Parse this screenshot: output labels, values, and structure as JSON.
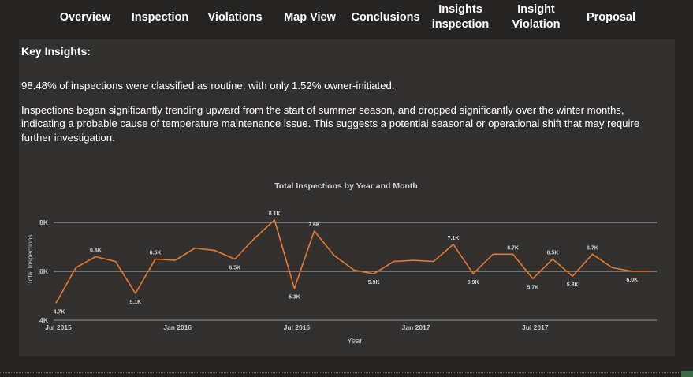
{
  "nav": {
    "tabs": [
      {
        "label": "Overview"
      },
      {
        "label": "Inspection"
      },
      {
        "label": "Violations"
      },
      {
        "label": "Map View"
      },
      {
        "label": "Conclusions"
      },
      {
        "label": "Insights\ninspection"
      },
      {
        "label": "Insight\nViolation"
      },
      {
        "label": "Proposal"
      }
    ]
  },
  "panel": {
    "title": "Key Insights:",
    "insight_1": "98.48% of inspections were classified as routine, with only 1.52% owner-initiated.",
    "insight_2": "Inspections began significantly trending upward from the start of summer season, and dropped significantly over the winter months, indicating a probable cause of temperature maintenance issue. This suggests a potential seasonal or operational shift that may require further investigation."
  },
  "colors": {
    "background": "#252423",
    "panel": "#323130",
    "line": "#e8792b",
    "text": "#ffffff"
  },
  "chart_data": {
    "type": "line",
    "title": "Total Inspections by Year and Month",
    "xlabel": "Year",
    "ylabel": "Total Inspections",
    "x_ticks": [
      "Jul 2015",
      "Jan 2016",
      "Jul 2016",
      "Jan 2017",
      "Jul 2017"
    ],
    "y_ticks": [
      "4K",
      "6K",
      "8K"
    ],
    "ylim": [
      4000,
      8000
    ],
    "x": [
      "2015-07",
      "2015-08",
      "2015-09",
      "2015-10",
      "2015-11",
      "2015-12",
      "2016-01",
      "2016-02",
      "2016-03",
      "2016-04",
      "2016-05",
      "2016-06",
      "2016-07",
      "2016-08",
      "2016-09",
      "2016-10",
      "2016-11",
      "2016-12",
      "2017-01",
      "2017-02",
      "2017-03",
      "2017-04",
      "2017-05",
      "2017-06",
      "2017-07",
      "2017-08",
      "2017-09",
      "2017-10",
      "2017-11",
      "2017-12",
      "2018-01"
    ],
    "values": [
      4700,
      6150,
      6600,
      6400,
      5100,
      6500,
      6450,
      6950,
      6850,
      6500,
      7350,
      8100,
      5300,
      7650,
      6650,
      6050,
      5900,
      6400,
      6450,
      6400,
      7100,
      5900,
      6700,
      6700,
      5700,
      6500,
      5800,
      6700,
      6150,
      6000,
      6000
    ],
    "data_labels": [
      {
        "index": 0,
        "text": "4.7K"
      },
      {
        "index": 2,
        "text": "6.6K"
      },
      {
        "index": 4,
        "text": "5.1K"
      },
      {
        "index": 5,
        "text": "6.5K"
      },
      {
        "index": 9,
        "text": "6.5K"
      },
      {
        "index": 11,
        "text": "8.1K"
      },
      {
        "index": 12,
        "text": "5.3K"
      },
      {
        "index": 13,
        "text": "7.6K"
      },
      {
        "index": 16,
        "text": "5.9K"
      },
      {
        "index": 20,
        "text": "7.1K"
      },
      {
        "index": 21,
        "text": "5.9K"
      },
      {
        "index": 23,
        "text": "6.7K"
      },
      {
        "index": 24,
        "text": "5.7K"
      },
      {
        "index": 25,
        "text": "6.5K"
      },
      {
        "index": 26,
        "text": "5.8K"
      },
      {
        "index": 27,
        "text": "6.7K"
      },
      {
        "index": 29,
        "text": "6.0K"
      }
    ],
    "grid": true,
    "legend": "none"
  }
}
